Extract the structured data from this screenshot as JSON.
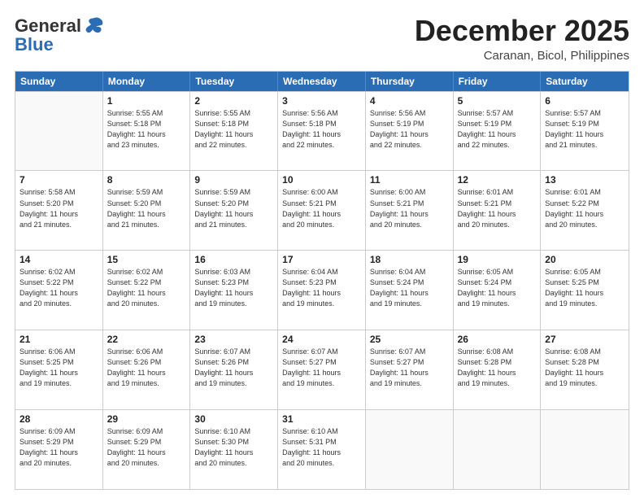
{
  "header": {
    "logo": {
      "line1": "General",
      "line2": "Blue"
    },
    "title": "December 2025",
    "location": "Caranan, Bicol, Philippines"
  },
  "calendar": {
    "days_of_week": [
      "Sunday",
      "Monday",
      "Tuesday",
      "Wednesday",
      "Thursday",
      "Friday",
      "Saturday"
    ],
    "weeks": [
      [
        {
          "day": "",
          "info": ""
        },
        {
          "day": "1",
          "info": "Sunrise: 5:55 AM\nSunset: 5:18 PM\nDaylight: 11 hours\nand 23 minutes."
        },
        {
          "day": "2",
          "info": "Sunrise: 5:55 AM\nSunset: 5:18 PM\nDaylight: 11 hours\nand 22 minutes."
        },
        {
          "day": "3",
          "info": "Sunrise: 5:56 AM\nSunset: 5:18 PM\nDaylight: 11 hours\nand 22 minutes."
        },
        {
          "day": "4",
          "info": "Sunrise: 5:56 AM\nSunset: 5:19 PM\nDaylight: 11 hours\nand 22 minutes."
        },
        {
          "day": "5",
          "info": "Sunrise: 5:57 AM\nSunset: 5:19 PM\nDaylight: 11 hours\nand 22 minutes."
        },
        {
          "day": "6",
          "info": "Sunrise: 5:57 AM\nSunset: 5:19 PM\nDaylight: 11 hours\nand 21 minutes."
        }
      ],
      [
        {
          "day": "7",
          "info": "Sunrise: 5:58 AM\nSunset: 5:20 PM\nDaylight: 11 hours\nand 21 minutes."
        },
        {
          "day": "8",
          "info": "Sunrise: 5:59 AM\nSunset: 5:20 PM\nDaylight: 11 hours\nand 21 minutes."
        },
        {
          "day": "9",
          "info": "Sunrise: 5:59 AM\nSunset: 5:20 PM\nDaylight: 11 hours\nand 21 minutes."
        },
        {
          "day": "10",
          "info": "Sunrise: 6:00 AM\nSunset: 5:21 PM\nDaylight: 11 hours\nand 20 minutes."
        },
        {
          "day": "11",
          "info": "Sunrise: 6:00 AM\nSunset: 5:21 PM\nDaylight: 11 hours\nand 20 minutes."
        },
        {
          "day": "12",
          "info": "Sunrise: 6:01 AM\nSunset: 5:21 PM\nDaylight: 11 hours\nand 20 minutes."
        },
        {
          "day": "13",
          "info": "Sunrise: 6:01 AM\nSunset: 5:22 PM\nDaylight: 11 hours\nand 20 minutes."
        }
      ],
      [
        {
          "day": "14",
          "info": "Sunrise: 6:02 AM\nSunset: 5:22 PM\nDaylight: 11 hours\nand 20 minutes."
        },
        {
          "day": "15",
          "info": "Sunrise: 6:02 AM\nSunset: 5:22 PM\nDaylight: 11 hours\nand 20 minutes."
        },
        {
          "day": "16",
          "info": "Sunrise: 6:03 AM\nSunset: 5:23 PM\nDaylight: 11 hours\nand 19 minutes."
        },
        {
          "day": "17",
          "info": "Sunrise: 6:04 AM\nSunset: 5:23 PM\nDaylight: 11 hours\nand 19 minutes."
        },
        {
          "day": "18",
          "info": "Sunrise: 6:04 AM\nSunset: 5:24 PM\nDaylight: 11 hours\nand 19 minutes."
        },
        {
          "day": "19",
          "info": "Sunrise: 6:05 AM\nSunset: 5:24 PM\nDaylight: 11 hours\nand 19 minutes."
        },
        {
          "day": "20",
          "info": "Sunrise: 6:05 AM\nSunset: 5:25 PM\nDaylight: 11 hours\nand 19 minutes."
        }
      ],
      [
        {
          "day": "21",
          "info": "Sunrise: 6:06 AM\nSunset: 5:25 PM\nDaylight: 11 hours\nand 19 minutes."
        },
        {
          "day": "22",
          "info": "Sunrise: 6:06 AM\nSunset: 5:26 PM\nDaylight: 11 hours\nand 19 minutes."
        },
        {
          "day": "23",
          "info": "Sunrise: 6:07 AM\nSunset: 5:26 PM\nDaylight: 11 hours\nand 19 minutes."
        },
        {
          "day": "24",
          "info": "Sunrise: 6:07 AM\nSunset: 5:27 PM\nDaylight: 11 hours\nand 19 minutes."
        },
        {
          "day": "25",
          "info": "Sunrise: 6:07 AM\nSunset: 5:27 PM\nDaylight: 11 hours\nand 19 minutes."
        },
        {
          "day": "26",
          "info": "Sunrise: 6:08 AM\nSunset: 5:28 PM\nDaylight: 11 hours\nand 19 minutes."
        },
        {
          "day": "27",
          "info": "Sunrise: 6:08 AM\nSunset: 5:28 PM\nDaylight: 11 hours\nand 19 minutes."
        }
      ],
      [
        {
          "day": "28",
          "info": "Sunrise: 6:09 AM\nSunset: 5:29 PM\nDaylight: 11 hours\nand 20 minutes."
        },
        {
          "day": "29",
          "info": "Sunrise: 6:09 AM\nSunset: 5:29 PM\nDaylight: 11 hours\nand 20 minutes."
        },
        {
          "day": "30",
          "info": "Sunrise: 6:10 AM\nSunset: 5:30 PM\nDaylight: 11 hours\nand 20 minutes."
        },
        {
          "day": "31",
          "info": "Sunrise: 6:10 AM\nSunset: 5:31 PM\nDaylight: 11 hours\nand 20 minutes."
        },
        {
          "day": "",
          "info": ""
        },
        {
          "day": "",
          "info": ""
        },
        {
          "day": "",
          "info": ""
        }
      ]
    ]
  }
}
